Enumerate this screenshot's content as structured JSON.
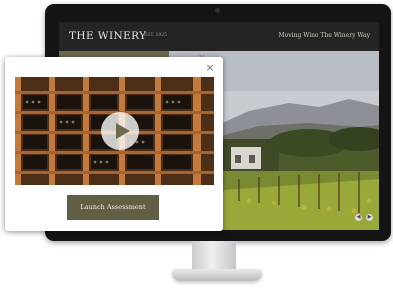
{
  "website": {
    "brand": "THE WINERY",
    "brand_sub": "EST. 1925",
    "tagline": "Moving Wine The Winery Way",
    "menu_fragment": "N"
  },
  "modal": {
    "close_glyph": "×",
    "button_label": "Launch Assessment"
  },
  "slider": {
    "prev_glyph": "◀",
    "next_glyph": "▶"
  },
  "colors": {
    "accent_olive": "#6b6a4e",
    "button": "#605e45",
    "topbar": "#242424"
  }
}
